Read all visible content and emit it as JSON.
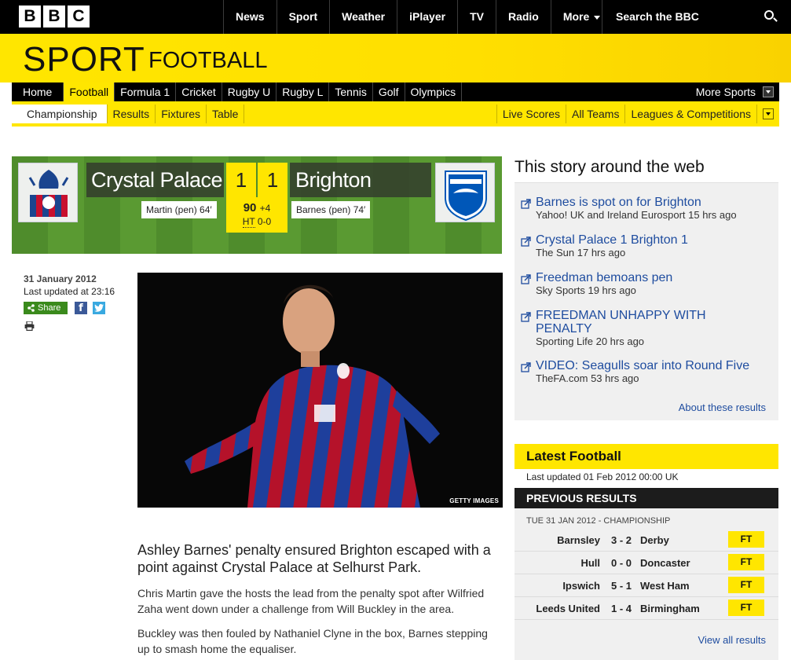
{
  "header": {
    "logo": [
      "B",
      "B",
      "C"
    ],
    "nav": [
      "News",
      "Sport",
      "Weather",
      "iPlayer",
      "TV",
      "Radio"
    ],
    "more_label": "More",
    "search_placeholder": "Search the BBC"
  },
  "masthead": {
    "title": "SPORT",
    "section": "FOOTBALL"
  },
  "main_nav": {
    "items": [
      "Home",
      "Football",
      "Formula 1",
      "Cricket",
      "Rugby U",
      "Rugby L",
      "Tennis",
      "Golf",
      "Olympics"
    ],
    "more_label": "More Sports"
  },
  "sub_nav": {
    "left": [
      "Championship",
      "Results",
      "Fixtures",
      "Table"
    ],
    "right": [
      "Live Scores",
      "All Teams",
      "Leagues & Competitions"
    ]
  },
  "match": {
    "home_team": "Crystal Palace",
    "away_team": "Brighton",
    "home_score": "1",
    "away_score": "1",
    "home_scorer": "Martin (pen) 64′",
    "away_scorer": "Barnes (pen) 74′",
    "minute": "90",
    "added_time": "+4",
    "ht_label": "HT",
    "ht_score": "0-0"
  },
  "article": {
    "date": "31 January 2012",
    "updated": "Last updated at 23:16",
    "share_label": "Share",
    "photo_credit": "GETTY IMAGES",
    "intro": "Ashley Barnes' penalty ensured Brighton escaped with a point against Crystal Palace at Selhurst Park.",
    "paragraphs": [
      "Chris Martin gave the hosts the lead from the penalty spot after Wilfried Zaha went down under a challenge from Will Buckley in the area.",
      "Buckley was then fouled by Nathaniel Clyne in the box, Barnes stepping up to smash home the equaliser."
    ]
  },
  "web_stories": {
    "title": "This story around the web",
    "items": [
      {
        "headline": "Barnes is spot on for Brighton",
        "source": "Yahoo! UK and Ireland Eurosport 15 hrs ago"
      },
      {
        "headline": "Crystal Palace 1 Brighton 1",
        "source": "The Sun 17 hrs ago"
      },
      {
        "headline": "Freedman bemoans pen",
        "source": "Sky Sports 19 hrs ago"
      },
      {
        "headline": "FREEDMAN UNHAPPY WITH PENALTY",
        "source": "Sporting Life 20 hrs ago"
      },
      {
        "headline": "VIDEO: Seagulls soar into Round Five",
        "source": "TheFA.com 53 hrs ago"
      }
    ],
    "about_label": "About these results"
  },
  "latest": {
    "title": "Latest Football",
    "updated": "Last updated 01 Feb 2012 00:00 UK",
    "previous_title": "PREVIOUS RESULTS",
    "competition": "TUE 31 JAN 2012 - CHAMPIONSHIP",
    "results": [
      {
        "home": "Barnsley",
        "score": "3 - 2",
        "away": "Derby",
        "status": "FT"
      },
      {
        "home": "Hull",
        "score": "0 - 0",
        "away": "Doncaster",
        "status": "FT"
      },
      {
        "home": "Ipswich",
        "score": "5 - 1",
        "away": "West Ham",
        "status": "FT"
      },
      {
        "home": "Leeds United",
        "score": "1 - 4",
        "away": "Birmingham",
        "status": "FT"
      }
    ],
    "view_all_label": "View all results"
  },
  "colors": {
    "accent": "#ffe600",
    "link": "#1e4c9f",
    "pitch": "#5a9a32",
    "share": "#3a8a1c"
  }
}
